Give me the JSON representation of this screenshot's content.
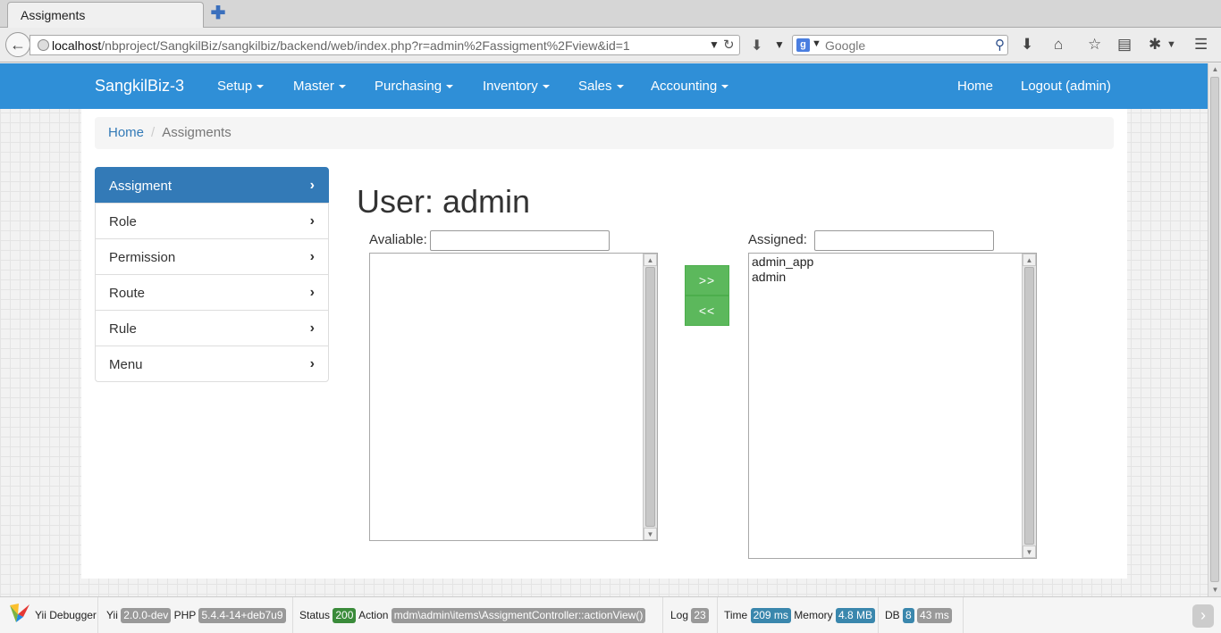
{
  "browser": {
    "tab_title": "Assigments",
    "new_tab": "✚",
    "url_host": "localhost",
    "url_path": "/nbproject/SangkilBiz/sangkilbiz/backend/web/index.php?r=admin%2Fassigment%2Fview&id=1",
    "search_engine_badge": "g",
    "search_placeholder": "Google"
  },
  "nav": {
    "brand": "SangkilBiz-3",
    "menus": [
      "Setup",
      "Master",
      "Purchasing",
      "Inventory",
      "Sales",
      "Accounting"
    ],
    "right": [
      "Home",
      "Logout (admin)"
    ]
  },
  "breadcrumb": {
    "home": "Home",
    "current": "Assigments"
  },
  "side_menu": [
    "Assigment",
    "Role",
    "Permission",
    "Route",
    "Rule",
    "Menu"
  ],
  "main": {
    "title": "User: admin",
    "available_label": "Avaliable:",
    "assigned_label": "Assigned:",
    "assign_button": ">>",
    "revoke_button": "<<",
    "available_items": [],
    "assigned_items": [
      "admin_app",
      "admin"
    ]
  },
  "debug": {
    "label": "Yii Debugger",
    "yii_label": "Yii",
    "yii_version": "2.0.0-dev",
    "php_label": "PHP",
    "php_version": "5.4.4-14+deb7u9",
    "status_label": "Status",
    "status": "200",
    "action_label": "Action",
    "action": "mdm\\admin\\items\\AssigmentController::actionView()",
    "log_label": "Log",
    "log_count": "23",
    "time_label": "Time",
    "time": "209 ms",
    "memory_label": "Memory",
    "memory": "4.8 MB",
    "db_label": "DB",
    "db_count": "8",
    "db_time": "43 ms",
    "toggle": "›"
  },
  "colors": {
    "navbar": "#2f8fd7",
    "active_menu": "#337ab7",
    "button_green": "#5cb85c"
  }
}
